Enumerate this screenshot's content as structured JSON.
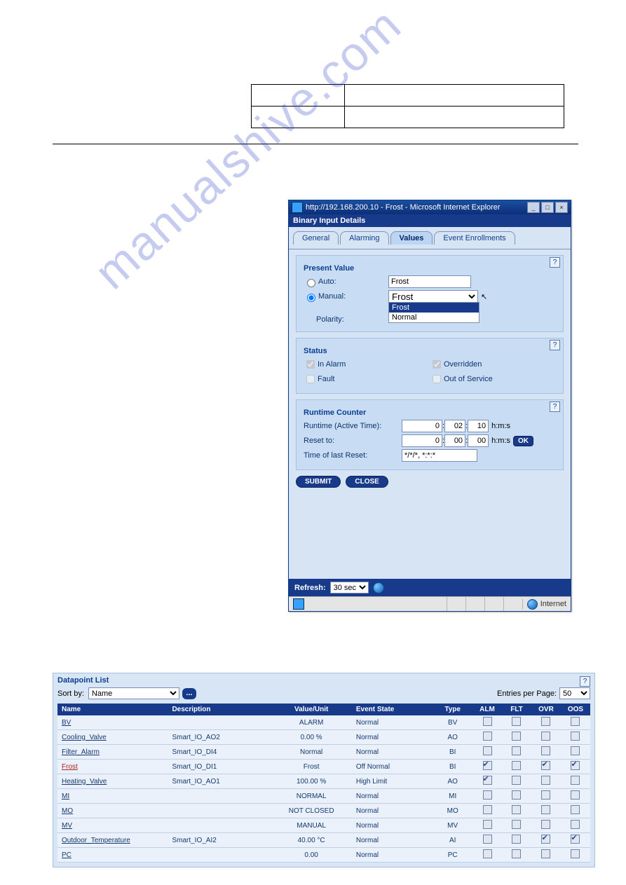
{
  "watermark": "manualshive.com",
  "dialog": {
    "url_title": "http://192.168.200.10 - Frost - Microsoft Internet Explorer",
    "win_min": "_",
    "win_max": "□",
    "win_close": "×",
    "subtitle": "Binary Input Details",
    "tabs": {
      "general": "General",
      "alarming": "Alarming",
      "values": "Values",
      "event_enrol": "Event Enrollments"
    },
    "help": "?",
    "presentValue": {
      "title": "Present Value",
      "auto_label": "Auto:",
      "auto_value": "Frost",
      "manual_label": "Manual:",
      "manual_value": "Frost",
      "options": {
        "opt1": "Frost",
        "opt2": "Normal"
      },
      "polarity_label": "Polarity:"
    },
    "status": {
      "title": "Status",
      "in_alarm": "In Alarm",
      "fault": "Fault",
      "overridden": "Overridden",
      "out_of_service": "Out of Service"
    },
    "runtime": {
      "title": "Runtime Counter",
      "runtime_label": "Runtime (Active Time):",
      "runtime_h": "0",
      "runtime_m": "02",
      "runtime_s": "10",
      "unit": "h:m:s",
      "reset_label": "Reset to:",
      "reset_h": "0",
      "reset_m": "00",
      "reset_s": "00",
      "ok": "OK",
      "last_reset_label": "Time of last Reset:",
      "last_reset_value": "*/*/*, *:*:*"
    },
    "buttons": {
      "submit": "SUBMIT",
      "close": "CLOSE"
    },
    "refresh": {
      "label": "Refresh:",
      "value": "30 sec"
    },
    "status_zone": "Internet"
  },
  "dplist": {
    "title": "Datapoint List",
    "sort_by_label": "Sort by:",
    "sort_by_value": "Name",
    "dots": "...",
    "entries_label": "Entries per Page:",
    "entries_value": "50",
    "help": "?",
    "cols": {
      "name": "Name",
      "desc": "Description",
      "value": "Value/Unit",
      "event": "Event State",
      "type": "Type",
      "alm": "ALM",
      "flt": "FLT",
      "ovr": "OVR",
      "oos": "OOS"
    },
    "rows": [
      {
        "name": "BV",
        "desc": "",
        "value": "ALARM",
        "event": "Normal",
        "type": "BV",
        "alm": false,
        "flt": false,
        "ovr": false,
        "oos": false,
        "alarm": false
      },
      {
        "name": "Cooling_Valve",
        "desc": "Smart_IO_AO2",
        "value": "0.00 %",
        "event": "Normal",
        "type": "AO",
        "alm": false,
        "flt": false,
        "ovr": false,
        "oos": false,
        "alarm": false
      },
      {
        "name": "Filter_Alarm",
        "desc": "Smart_IO_DI4",
        "value": "Normal",
        "event": "Normal",
        "type": "BI",
        "alm": false,
        "flt": false,
        "ovr": false,
        "oos": false,
        "alarm": false
      },
      {
        "name": "Frost",
        "desc": "Smart_IO_DI1",
        "value": "Frost",
        "event": "Off Normal",
        "type": "BI",
        "alm": true,
        "flt": false,
        "ovr": true,
        "oos": true,
        "alarm": true
      },
      {
        "name": "Heating_Valve",
        "desc": "Smart_IO_AO1",
        "value": "100.00 %",
        "event": "High Limit",
        "type": "AO",
        "alm": true,
        "flt": false,
        "ovr": false,
        "oos": false,
        "alarm": false
      },
      {
        "name": "MI",
        "desc": "",
        "value": "NORMAL",
        "event": "Normal",
        "type": "MI",
        "alm": false,
        "flt": false,
        "ovr": false,
        "oos": false,
        "alarm": false
      },
      {
        "name": "MO",
        "desc": "",
        "value": "NOT CLOSED",
        "event": "Normal",
        "type": "MO",
        "alm": false,
        "flt": false,
        "ovr": false,
        "oos": false,
        "alarm": false
      },
      {
        "name": "MV",
        "desc": "",
        "value": "MANUAL",
        "event": "Normal",
        "type": "MV",
        "alm": false,
        "flt": false,
        "ovr": false,
        "oos": false,
        "alarm": false
      },
      {
        "name": "Outdoor_Temperature",
        "desc": "Smart_IO_AI2",
        "value": "40.00 °C",
        "event": "Normal",
        "type": "AI",
        "alm": false,
        "flt": false,
        "ovr": true,
        "oos": true,
        "alarm": false
      },
      {
        "name": "PC",
        "desc": "",
        "value": "0.00",
        "event": "Normal",
        "type": "PC",
        "alm": false,
        "flt": false,
        "ovr": false,
        "oos": false,
        "alarm": false
      }
    ]
  }
}
